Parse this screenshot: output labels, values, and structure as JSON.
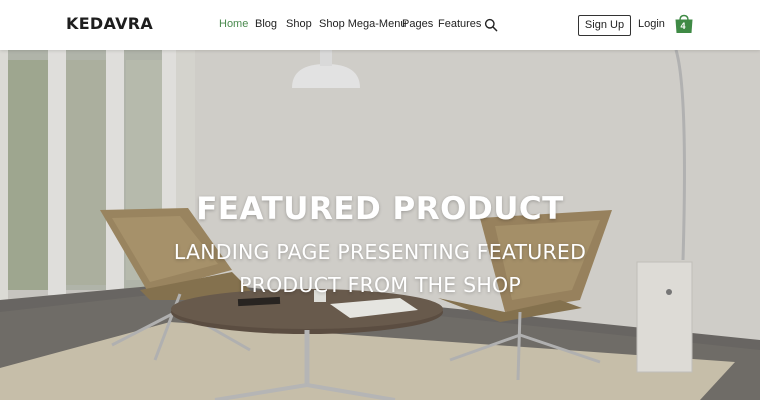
{
  "site": {
    "logo": "KEDAVRA"
  },
  "nav": {
    "items": [
      {
        "label": "Home",
        "active": true
      },
      {
        "label": "Blog",
        "active": false
      },
      {
        "label": "Shop",
        "active": false
      },
      {
        "label": "Shop Mega-Menu",
        "active": false
      },
      {
        "label": "Pages",
        "active": false
      },
      {
        "label": "Features",
        "active": false
      }
    ]
  },
  "header_actions": {
    "signup_label": "Sign Up",
    "login_label": "Login",
    "cart_count": "4"
  },
  "hero": {
    "title": "FEATURED PRODUCT",
    "subtitle_line1": "LANDING PAGE PRESENTING FEATURED",
    "subtitle_line2": "PRODUCT FROM THE SHOP"
  },
  "colors": {
    "accent": "#4a8a4e",
    "cart": "#3f8a45",
    "text": "#222222"
  },
  "icons": [
    "search-icon",
    "cart-icon"
  ]
}
